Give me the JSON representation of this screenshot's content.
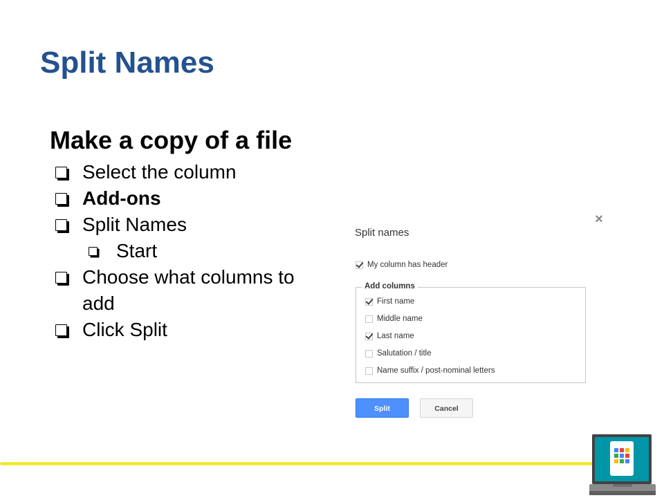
{
  "slide": {
    "title": "Split Names"
  },
  "content": {
    "heading": "Make a copy of a file",
    "steps": [
      {
        "label": "Select the column"
      },
      {
        "label": "Add-ons"
      },
      {
        "label": "Split Names"
      },
      {
        "label": "Start"
      },
      {
        "label": "Choose what columns to add"
      },
      {
        "label": "Click Split"
      }
    ]
  },
  "dialog": {
    "title": "Split names",
    "close_glyph": "×",
    "header_option": {
      "label": "My column has header",
      "checked": true
    },
    "add_columns": {
      "legend": "Add columns",
      "options": [
        {
          "label": "First name",
          "checked": true
        },
        {
          "label": "Middle name",
          "checked": false
        },
        {
          "label": "Last name",
          "checked": true
        },
        {
          "label": "Salutation / title",
          "checked": false
        },
        {
          "label": "Name suffix / post-nominal letters",
          "checked": false
        }
      ]
    },
    "split_label": "Split",
    "cancel_label": "Cancel"
  },
  "colors": {
    "title": "#24518f",
    "accent_line": "#efe800",
    "primary_button": "#4d90fe"
  },
  "icons": {
    "corner": "laptop-apps-icon",
    "bullet": "checkbox-bullet-icon"
  }
}
